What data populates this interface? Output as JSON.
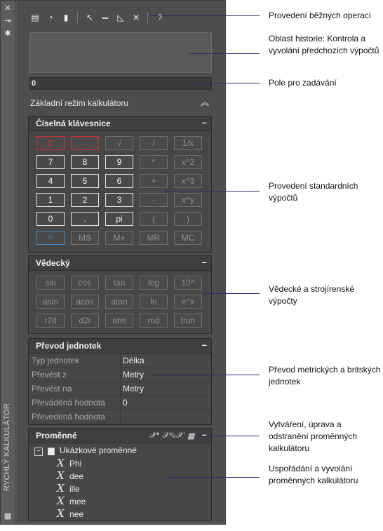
{
  "palette": {
    "title": "RYCHLÝ KALKULÁTOR",
    "side_icons": [
      "close-icon",
      "auto-hide-icon",
      "properties-icon",
      "calculator-icon"
    ]
  },
  "toolbar": {
    "icons": [
      "clear-icon",
      "clear-history-icon",
      "paste-icon",
      "get-coordinates-icon",
      "distance-icon",
      "angle-icon",
      "intersection-icon",
      "help-icon"
    ]
  },
  "input": {
    "value": "0"
  },
  "mode": {
    "label": "Základní režim kalkulátoru"
  },
  "number_pad": {
    "title": "Číselná klávesnice",
    "keys": [
      [
        "C",
        "←",
        "√",
        "/",
        "1/x"
      ],
      [
        "7",
        "8",
        "9",
        "*",
        "x^2"
      ],
      [
        "4",
        "5",
        "6",
        "+",
        "x^3"
      ],
      [
        "1",
        "2",
        "3",
        "-",
        "x^y"
      ],
      [
        "0",
        ".",
        "pi",
        "(",
        ")"
      ],
      [
        "=",
        "MS",
        "M+",
        "MR",
        "MC"
      ]
    ]
  },
  "scientific": {
    "title": "Vědecký",
    "keys": [
      [
        "sin",
        "cos",
        "tan",
        "log",
        "10^"
      ],
      [
        "asin",
        "acos",
        "atan",
        "ln",
        "e^x"
      ],
      [
        "r2d",
        "d2r",
        "abs",
        "rnd",
        "trun"
      ]
    ]
  },
  "units": {
    "title": "Převod jednotek",
    "rows": [
      {
        "name": "Typ jednotek",
        "value": "Délka"
      },
      {
        "name": "Převést z",
        "value": "Metry"
      },
      {
        "name": "Převést na",
        "value": "Metry"
      },
      {
        "name": "Převáděná hodnota",
        "value": "0"
      },
      {
        "name": "Převedená hodnota",
        "value": ""
      }
    ]
  },
  "variables": {
    "title": "Proměnné",
    "category": "Ukázkové proměnné",
    "items": [
      "Phi",
      "dee",
      "ille",
      "mee",
      "nee"
    ]
  },
  "annotations": [
    "Provedení běžných operací",
    "Oblast historie: Kontrola a vyvolání předchozích výpočtů",
    "Pole pro zadávání",
    "Provedení standardních výpočtů",
    "Vědecké a strojírenské výpočty",
    "Převod metrických a britských jednotek",
    "Vytváření, úprava a odstranění proměnných kalkulátoru",
    "Uspořádání a vyvolání proměnných kalkulátoru"
  ]
}
